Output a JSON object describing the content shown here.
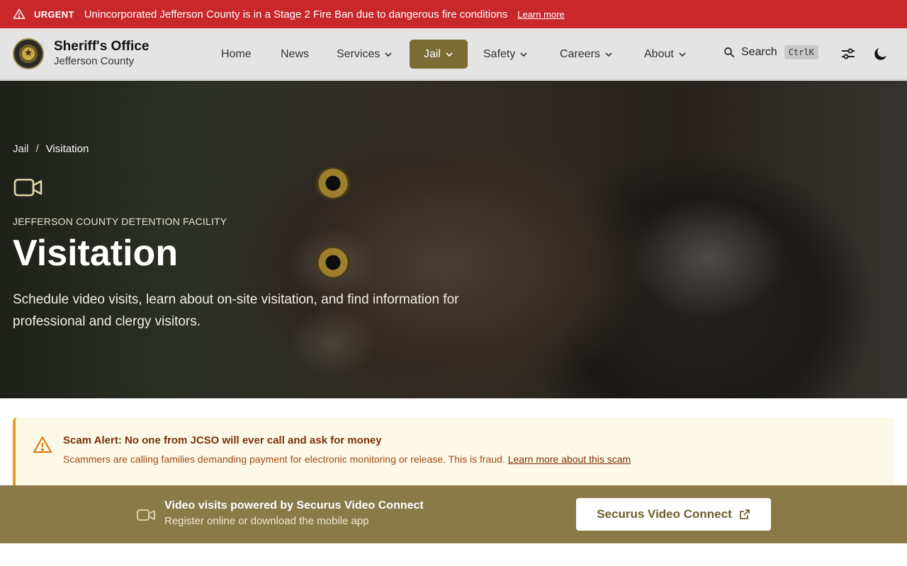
{
  "urgent": {
    "tag": "URGENT",
    "message": "Unincorporated Jefferson County is in a Stage 2 Fire Ban due to dangerous fire conditions",
    "link": "Learn more",
    "color": "#c8282a"
  },
  "brand": {
    "title": "Sheriff's Office",
    "subtitle": "Jefferson County"
  },
  "nav": {
    "items": [
      {
        "label": "Home"
      },
      {
        "label": "News"
      },
      {
        "label": "Services"
      },
      {
        "label": "Jail"
      },
      {
        "label": "Safety"
      },
      {
        "label": "Careers"
      },
      {
        "label": "About"
      }
    ],
    "active": "Jail",
    "accent": "#7b6b34"
  },
  "search": {
    "label": "Search",
    "shortcut": "CtrlK"
  },
  "icons": {
    "settings": "sliders-icon",
    "theme": "moon-icon"
  },
  "hero": {
    "breadcrumb": [
      "Jail",
      "Visitation"
    ],
    "icon": "video-camera-icon",
    "eyebrow": "JEFFERSON COUNTY DETENTION FACILITY",
    "title": "Visitation",
    "lead": "Schedule video visits, learn about on-site visitation, and find information for professional and clergy visitors."
  },
  "alert": {
    "title": "Scam Alert: No one from JCSO will ever call and ask for money",
    "body": "Scammers are calling families demanding payment for electronic monitoring or release. This is fraud.",
    "link": "Learn more about this scam",
    "accent": "#e59a2a"
  },
  "video": {
    "title": "Video visits powered by Securus Video Connect",
    "subtitle": "Register online or download the mobile app",
    "button": "Securus Video Connect",
    "bg": "#8a7a48"
  }
}
